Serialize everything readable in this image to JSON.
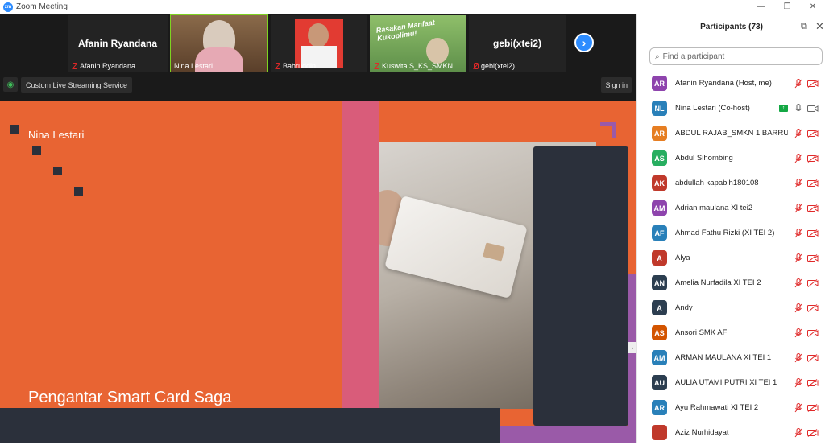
{
  "window": {
    "title": "Zoom Meeting",
    "logo_text": "zm"
  },
  "strip": {
    "tiles": [
      {
        "big_name": "Afanin Ryandana",
        "name": "Afanin Ryandana"
      },
      {
        "name": "Nina Lestari"
      },
      {
        "name": "Bahruddin"
      },
      {
        "name": "Kuswita S_KS_SMKN ...",
        "banner": "Rasakan Manfaat Kukoplimu!"
      },
      {
        "big_name": "gebi(xtei2)",
        "name": "gebi(xtei2)"
      }
    ]
  },
  "toolbar": {
    "stream_label": "Custom Live Streaming Service",
    "signin_label": "Sign in"
  },
  "slide": {
    "presenter_name": "Nina Lestari",
    "title": "Pengantar Smart Card Saga"
  },
  "participants": {
    "title": "Participants (73)",
    "search_placeholder": "Find a participant",
    "list": [
      {
        "initials": "AR",
        "name": "Afanin Ryandana (Host, me)",
        "color": "#8e44ad"
      },
      {
        "initials": "NL",
        "name": "Nina Lestari (Co-host)",
        "color": "#2980b9"
      },
      {
        "initials": "AR",
        "name": "ABDUL RAJAB_SMKN 1 BARRU",
        "color": "#e67e22"
      },
      {
        "initials": "AS",
        "name": "Abdul Sihombing",
        "color": "#27ae60"
      },
      {
        "initials": "AK",
        "name": "abdullah kapabih180108",
        "color": "#c0392b"
      },
      {
        "initials": "AM",
        "name": "Adrian maulana XI tei2",
        "color": "#8e44ad"
      },
      {
        "initials": "AF",
        "name": "Ahmad Fathu Rizki (XI TEI 2)",
        "color": "#2980b9"
      },
      {
        "initials": "A",
        "name": "Alya",
        "color": "#c0392b"
      },
      {
        "initials": "AN",
        "name": "Amelia Nurfadila XI TEI 2",
        "color": "#2c3e50"
      },
      {
        "initials": "A",
        "name": "Andy",
        "color": "#2c3e50"
      },
      {
        "initials": "AS",
        "name": "Ansori SMK AF",
        "color": "#d35400"
      },
      {
        "initials": "AM",
        "name": "ARMAN MAULANA XI TEI 1",
        "color": "#2980b9"
      },
      {
        "initials": "AU",
        "name": "AULIA UTAMI PUTRI XI TEI 1",
        "color": "#2c3e50"
      },
      {
        "initials": "AR",
        "name": "Ayu Rahmawati XI TEI 2",
        "color": "#2980b9"
      },
      {
        "initials": "",
        "name": "Aziz Nurhidayat",
        "color": "#c0392b"
      }
    ]
  }
}
